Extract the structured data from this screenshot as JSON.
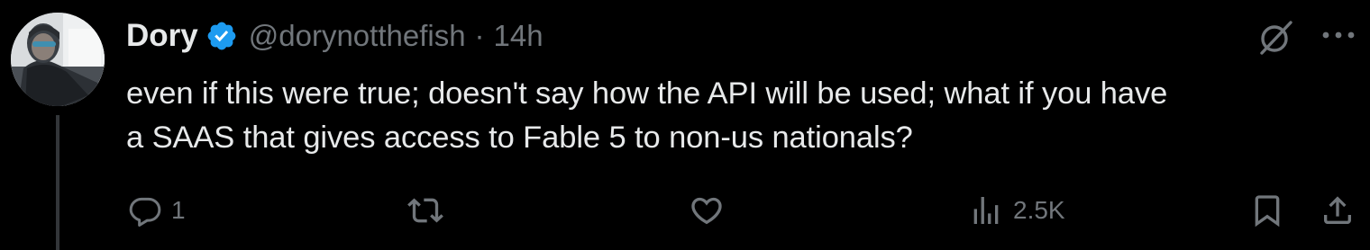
{
  "post": {
    "author": {
      "display_name": "Dory",
      "handle": "@dorynotthefish",
      "verified": true
    },
    "separator": "·",
    "time": "14h",
    "text_lines": [
      "even if this were true; doesn't say how the API will be used; what if you have",
      "a SAAS that gives access to Fable 5 to non-us nationals?"
    ],
    "actions": {
      "reply_count": "1",
      "repost_count": "",
      "like_count": "",
      "views_count": "2.5K"
    }
  },
  "icons": {
    "verified": "verified-badge-icon",
    "grok": "grok-icon",
    "more": "more-icon",
    "reply": "reply-icon",
    "repost": "repost-icon",
    "like": "like-icon",
    "views": "views-icon",
    "bookmark": "bookmark-icon",
    "share": "share-icon"
  },
  "colors": {
    "background": "#000000",
    "text_primary": "#e7e9ea",
    "text_secondary": "#71767b",
    "verified_blue": "#1d9bf0",
    "thread_line": "#333639"
  }
}
